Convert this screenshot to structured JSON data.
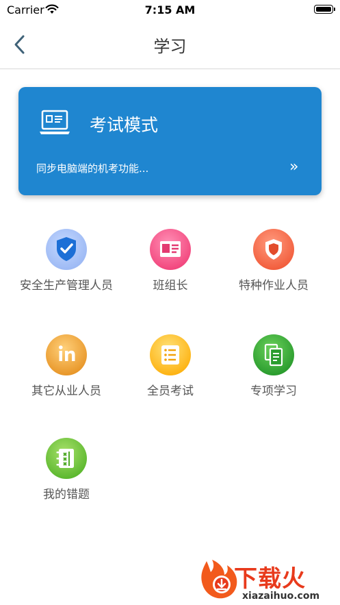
{
  "status_bar": {
    "carrier": "Carrier",
    "time": "7:15 AM"
  },
  "nav": {
    "title": "学习"
  },
  "exam_card": {
    "title": "考试模式",
    "subtitle": "同步电脑端的机考功能...",
    "arrow": "»",
    "color": "#1f86d0"
  },
  "grid": [
    {
      "label": "安全生产管理人员",
      "icon": "shield-check-icon"
    },
    {
      "label": "班组长",
      "icon": "id-card-icon"
    },
    {
      "label": "特种作业人员",
      "icon": "shield-icon"
    },
    {
      "label": "其它从业人员",
      "icon": "linkedin-icon"
    },
    {
      "label": "全员考试",
      "icon": "checklist-icon"
    },
    {
      "label": "专项学习",
      "icon": "documents-icon"
    },
    {
      "label": "我的错题",
      "icon": "error-notebook-icon"
    }
  ],
  "watermark": {
    "text": "下载火",
    "url": "xiazaihuo.com"
  }
}
